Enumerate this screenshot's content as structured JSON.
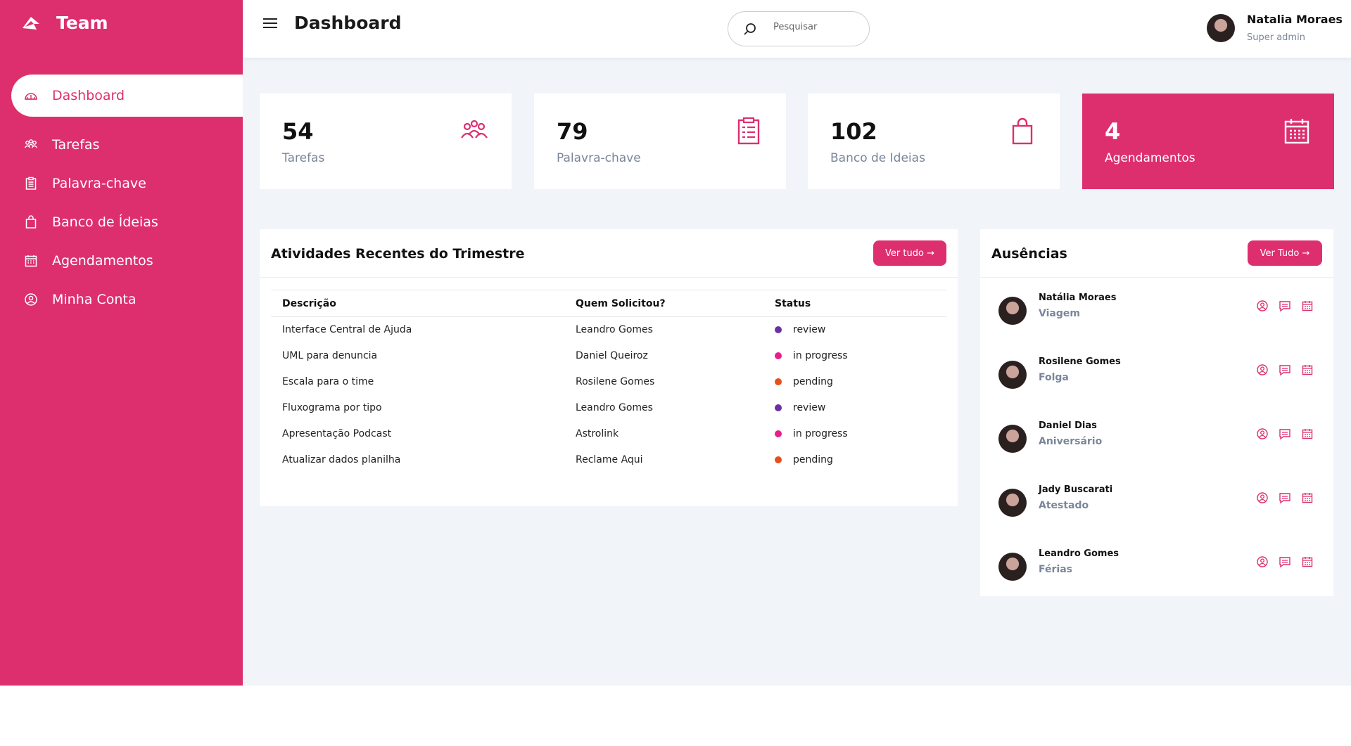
{
  "brand": {
    "name": "Team"
  },
  "sidebar": {
    "items": [
      {
        "label": "Dashboard",
        "icon": "dashboard-icon"
      },
      {
        "label": "Tarefas",
        "icon": "people-icon"
      },
      {
        "label": "Palavra-chave",
        "icon": "clipboard-icon"
      },
      {
        "label": "Banco de Ídeias",
        "icon": "bag-icon"
      },
      {
        "label": "Agendamentos",
        "icon": "calendar-icon"
      },
      {
        "label": "Minha Conta",
        "icon": "account-icon"
      }
    ]
  },
  "header": {
    "title": "Dashboard",
    "search_placeholder": "Pesquisar",
    "user_name": "Natalia Moraes",
    "user_role": "Super admin"
  },
  "stats": [
    {
      "value": "54",
      "label": "Tarefas",
      "icon": "people-icon"
    },
    {
      "value": "79",
      "label": "Palavra-chave",
      "icon": "clipboard-icon"
    },
    {
      "value": "102",
      "label": "Banco de Ideias",
      "icon": "bag-icon"
    },
    {
      "value": "4",
      "label": "Agendamentos",
      "icon": "calendar-icon"
    }
  ],
  "activities": {
    "title": "Atividades Recentes do Trimestre",
    "button": "Ver tudo →",
    "columns": [
      "Descrição",
      "Quem Solicitou?",
      "Status"
    ],
    "rows": [
      {
        "desc": "Interface Central de Ajuda",
        "who": "Leandro Gomes",
        "status": "review"
      },
      {
        "desc": "UML para denuncia",
        "who": "Daniel Queiroz",
        "status": "in progress"
      },
      {
        "desc": "Escala para o time",
        "who": "Rosilene Gomes",
        "status": "pending"
      },
      {
        "desc": "Fluxograma por tipo",
        "who": "Leandro Gomes",
        "status": "review"
      },
      {
        "desc": "Apresentação Podcast",
        "who": "Astrolink",
        "status": "in progress"
      },
      {
        "desc": "Atualizar dados planilha",
        "who": "Reclame Aqui",
        "status": "pending"
      }
    ],
    "status_colors": {
      "review": "#6b2fa3",
      "in progress": "#e91e8c",
      "pending": "#e8501a"
    }
  },
  "absences": {
    "title": "Ausências",
    "button": "Ver Tudo →",
    "items": [
      {
        "name": "Natália Moraes",
        "type": "Viagem"
      },
      {
        "name": "Rosilene Gomes",
        "type": "Folga"
      },
      {
        "name": "Daniel Dias",
        "type": "Aniversário"
      },
      {
        "name": "Jady Buscarati",
        "type": "Atestado"
      },
      {
        "name": "Leandro Gomes",
        "type": "Férias"
      }
    ]
  },
  "colors": {
    "accent": "#dd2f6e",
    "background": "#f1f5f9",
    "muted": "#7a869a"
  }
}
